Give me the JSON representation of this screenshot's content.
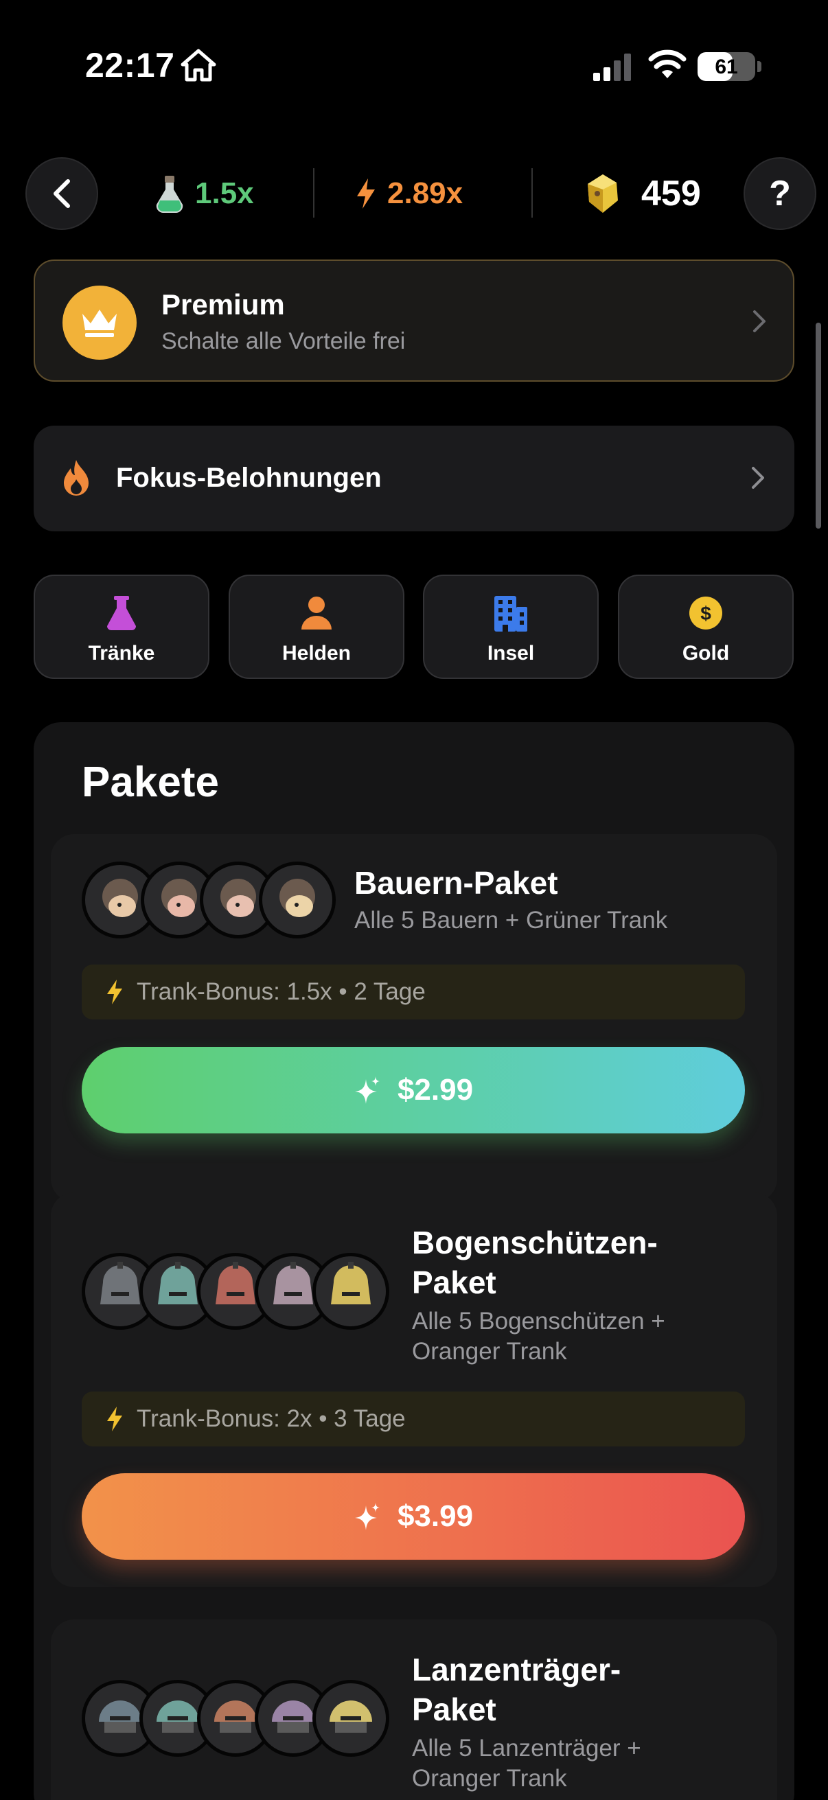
{
  "status_bar": {
    "time": "22:17",
    "battery": "61",
    "battery_level": 0.61
  },
  "top_bar": {
    "potion_multiplier": "1.5x",
    "energy_multiplier": "2.89x",
    "gems": "459",
    "help_label": "?"
  },
  "premium": {
    "title": "Premium",
    "subtitle": "Schalte alle Vorteile frei"
  },
  "fokus": {
    "label": "Fokus-Belohnungen"
  },
  "categories": [
    {
      "label": "Tränke",
      "icon": "flask-icon",
      "color": "#c44fd8"
    },
    {
      "label": "Helden",
      "icon": "person-icon",
      "color": "#f08a3c"
    },
    {
      "label": "Insel",
      "icon": "building-icon",
      "color": "#3c7bea"
    },
    {
      "label": "Gold",
      "icon": "coin-icon",
      "color": "#f2c230"
    }
  ],
  "packages": {
    "title": "Pakete",
    "items": [
      {
        "title": "Bauern-Paket",
        "subtitle": "Alle 5 Bauern + Grüner Trank",
        "bonus": "Trank-Bonus: 1.5x • 2 Tage",
        "price": "$2.99",
        "button_color": "green"
      },
      {
        "title_line1": "Bogenschützen-",
        "title_line2": "Paket",
        "subtitle_line1": "Alle 5 Bogenschützen +",
        "subtitle_line2": "Oranger Trank",
        "bonus": "Trank-Bonus: 2x • 3 Tage",
        "price": "$3.99",
        "button_color": "orange"
      },
      {
        "title_line1": "Lanzenträger-",
        "title_line2": "Paket",
        "subtitle_line1": "Alle 5 Lanzenträger +",
        "subtitle_line2": "Oranger Trank"
      }
    ]
  }
}
